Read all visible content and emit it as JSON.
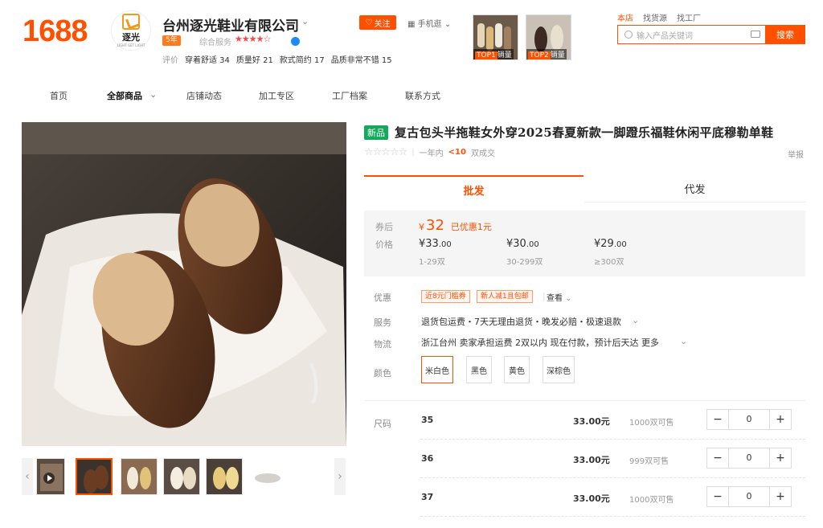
{
  "brand": {
    "logo": "1688"
  },
  "shop": {
    "avatar_text": "逐光",
    "avatar_sub": "LIGHT GET LIGHT",
    "name": "台州逐光鞋业有限公司",
    "years_badge": "5年",
    "service_label": "综合服务",
    "rating_stars": "★★★★☆",
    "review_label": "评价",
    "review_tags": [
      "穿着舒适 34",
      "质量好 21",
      "款式简约 17",
      "品质非常不错 15"
    ],
    "follow_label": "关注",
    "mobile_label": "手机逛"
  },
  "top_products": [
    {
      "rank": "TOP1",
      "label": "销量"
    },
    {
      "rank": "TOP2",
      "label": "销量"
    }
  ],
  "search": {
    "tabs": [
      "本店",
      "找货源",
      "找工厂"
    ],
    "active_tab": "本店",
    "placeholder": "输入产品关键词",
    "button": "搜索"
  },
  "nav": {
    "items": [
      "首页",
      "全部商品",
      "店铺动态",
      "加工专区",
      "工厂档案",
      "联系方式"
    ],
    "active": "全部商品"
  },
  "product": {
    "badge": "新品",
    "title": "复古包头半拖鞋女外穿2025春夏新款一脚蹬乐福鞋休闲平底穆勒单鞋",
    "stars": "☆☆☆☆☆",
    "sales_prefix": "一年内",
    "sales_value": "<10",
    "sales_suffix": "双成交",
    "report": "举报"
  },
  "tabs": {
    "wholesale": "批发",
    "agent": "代发"
  },
  "pricing": {
    "coupon_label": "券后",
    "coupon_price": "32",
    "coupon_saved": "已优惠1元",
    "price_label": "价格",
    "tiers": [
      {
        "price": "¥33",
        "decimals": ".00",
        "qty": "1-29双"
      },
      {
        "price": "¥30",
        "decimals": ".00",
        "qty": "30-299双"
      },
      {
        "price": "¥29",
        "decimals": ".00",
        "qty": "≥300双"
      }
    ]
  },
  "offers": {
    "label": "优惠",
    "tags": [
      "近8元门槛券",
      "新人减1且包邮"
    ],
    "view": "查看"
  },
  "service": {
    "label": "服务",
    "text": "退货包运费・7天无理由退货・晚发必赔・极速退款"
  },
  "logistics": {
    "label": "物流",
    "text": "浙江台州  卖家承担运费  2双以内 现在付款，预计后天达  更多"
  },
  "colors": {
    "label": "颜色",
    "options": [
      "米白色",
      "黑色",
      "黄色",
      "深棕色"
    ],
    "selected": "米白色"
  },
  "sizes": {
    "label": "尺码",
    "rows": [
      {
        "size": "35",
        "price": "33.00元",
        "stock": "1000双可售",
        "qty": "0"
      },
      {
        "size": "36",
        "price": "33.00元",
        "stock": "999双可售",
        "qty": "0"
      },
      {
        "size": "37",
        "price": "33.00元",
        "stock": "1000双可售",
        "qty": "0"
      }
    ]
  },
  "colors_theme": {
    "accent": "#ff5000",
    "new_badge": "#14a95b"
  }
}
